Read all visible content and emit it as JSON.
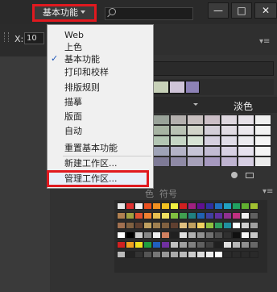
{
  "topbar": {
    "workspace_label": "基本功能",
    "minimize_glyph": "—",
    "maximize_glyph": "□",
    "close_glyph": "✕"
  },
  "control": {
    "x_label": "X:",
    "x_value": "10"
  },
  "menu": {
    "items": [
      {
        "label": "Web",
        "checked": false
      },
      {
        "label": "上色",
        "checked": false
      },
      {
        "label": "基本功能",
        "checked": true
      },
      {
        "label": "打印和校样",
        "checked": false
      },
      {
        "label": "排版规则",
        "checked": false
      },
      {
        "label": "描摹",
        "checked": false
      },
      {
        "label": "版面",
        "checked": false
      },
      {
        "label": "自动",
        "checked": false
      },
      {
        "label": "重置基本功能",
        "checked": false
      },
      {
        "label": "新建工作区...",
        "checked": false,
        "highlighted": true
      },
      {
        "label": "管理工作区...",
        "checked": false
      }
    ],
    "check_glyph": "✓"
  },
  "color_panel": {
    "theme_label": "淡色",
    "swatch_colors": [
      "#c7d1b8",
      "#cfc4d8",
      "#8d82b6"
    ]
  },
  "swatches_panel": {
    "tab_fragment": "色",
    "tab_label": "符号"
  },
  "colors": {
    "highlight_border": "#e0191f",
    "check": "#1e56b8"
  }
}
